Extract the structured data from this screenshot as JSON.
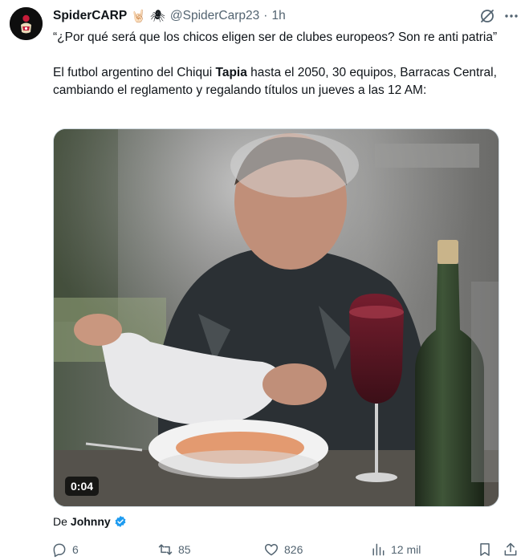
{
  "tweet": {
    "author": {
      "display_name": "SpiderCARP",
      "emojis": [
        "🤘🏻",
        "🕷"
      ],
      "handle": "@SpiderCarp23",
      "time": "1h",
      "avatar_icon": "avatar-image"
    },
    "text": {
      "line1": "“¿Por qué será que los chicos eligen ser de clubes europeos? Son re anti patria”",
      "line2_prefix": "El futbol argentino del Chiqui ",
      "line2_bold": "Tapia",
      "line2_suffix": " hasta el 2050, 30 equipos, Barracas Central, cambiando el reglamento y regalando títulos un jueves a las 12 AM:"
    },
    "media": {
      "type": "video",
      "duration": "0:04"
    },
    "attribution": {
      "prefix": "De",
      "author": "Johnny",
      "verified_icon": "verified-badge-icon"
    },
    "actions": {
      "replies": "6",
      "reposts": "85",
      "likes": "826",
      "views": "12 mil"
    },
    "colors": {
      "text": "#0f1419",
      "secondary": "#536471",
      "verified": "#1d9bf0",
      "border": "#cfd9de"
    }
  }
}
